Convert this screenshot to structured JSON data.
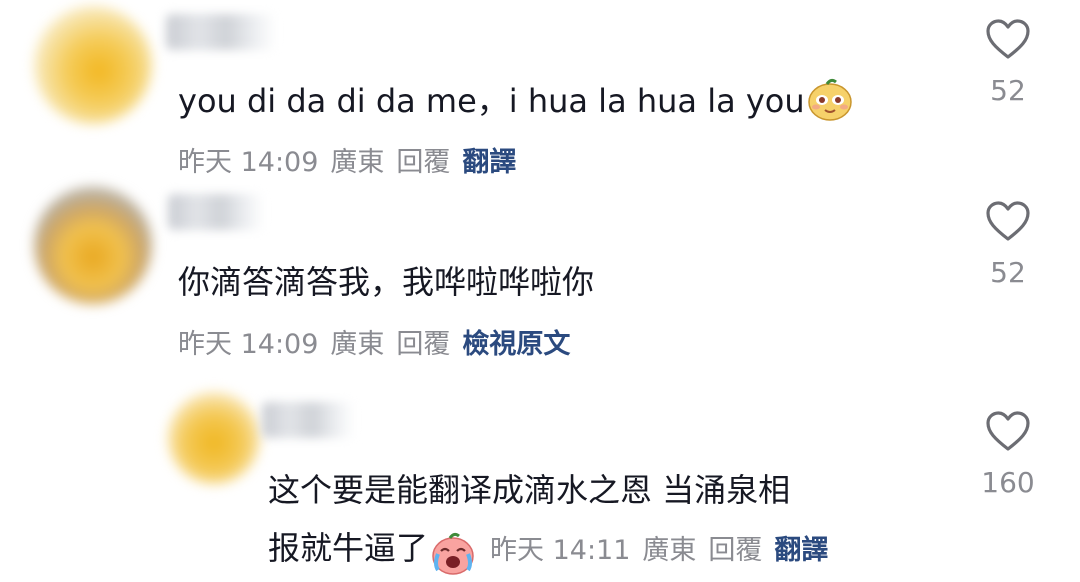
{
  "comments": [
    {
      "text": "you di da di da me，i hua la hua la you",
      "emoji": "sly-face-emoji",
      "time": "昨天 14:09",
      "location": "廣東",
      "reply": "回覆",
      "action": "翻譯",
      "likes": "52"
    },
    {
      "text": "你滴答滴答我，我哗啦哗啦你",
      "time": "昨天 14:09",
      "location": "廣東",
      "reply": "回覆",
      "action": "檢視原文",
      "likes": "52"
    },
    {
      "text_line1": "这个要是能翻译成滴水之恩 当涌泉相",
      "text_line2": "报就牛逼了",
      "emoji": "crying-face-emoji",
      "time": "昨天 14:11",
      "location": "廣東",
      "reply": "回覆",
      "action": "翻譯",
      "likes": "160"
    }
  ],
  "icons": {
    "like": "heart-outline-icon"
  },
  "colors": {
    "text": "#161823",
    "meta": "#8a8b91",
    "translate": "#2b4a7f"
  }
}
